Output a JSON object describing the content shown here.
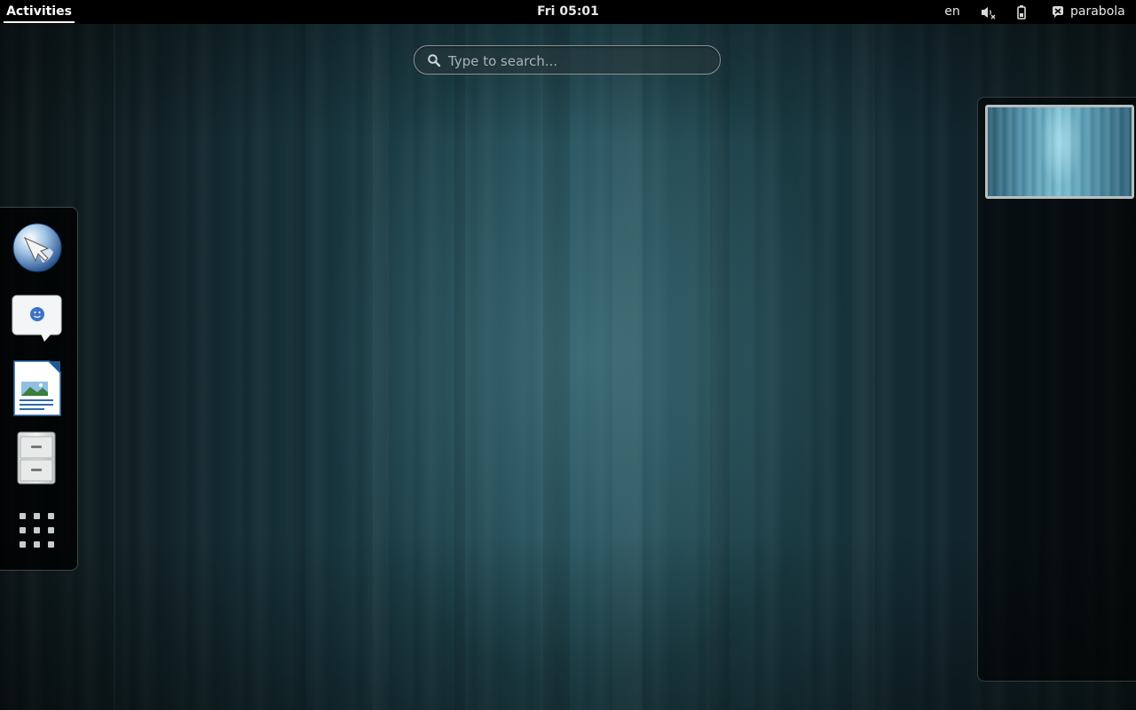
{
  "topbar": {
    "activities_label": "Activities",
    "clock": "Fri 05:01",
    "language": "en",
    "username": "parabola",
    "icons": [
      "volume-muted-icon",
      "battery-icon",
      "user-status-icon"
    ]
  },
  "search": {
    "placeholder": "Type to search...",
    "value": ""
  },
  "dash": {
    "items": [
      {
        "name": "web-browser",
        "icon": "globe-icon"
      },
      {
        "name": "messaging",
        "icon": "chat-bubble-icon"
      },
      {
        "name": "document-writer",
        "icon": "writer-document-icon"
      },
      {
        "name": "file-manager",
        "icon": "file-cabinet-icon"
      },
      {
        "name": "show-applications",
        "icon": "app-grid-icon"
      }
    ]
  },
  "workspaces": {
    "count": 1,
    "active_index": 0
  },
  "colors": {
    "topbar_bg": "#000000",
    "text": "#e6e6e6",
    "wallpaper_center": "#24505a"
  }
}
